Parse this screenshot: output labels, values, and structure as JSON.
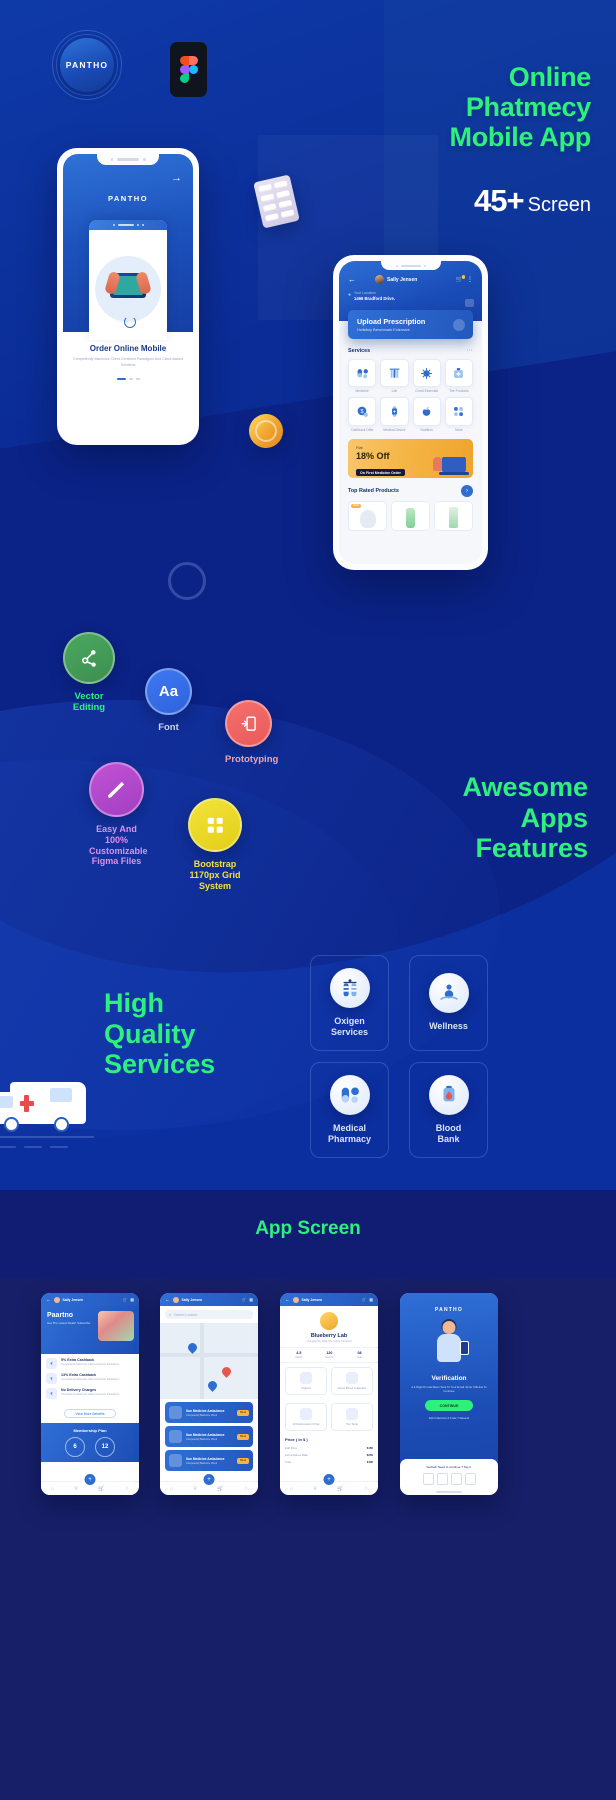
{
  "brand": {
    "name": "PANTHO",
    "figma_icon": "figma-icon"
  },
  "hero": {
    "title_line1": "Online",
    "title_line2": "Phatmecy",
    "title_line3": "Mobile App",
    "screens_count": "45+",
    "screens_label": "Screen",
    "accent_green": "#2ef07d",
    "background_blue": "#0c2f9f"
  },
  "phone_onboarding": {
    "brand": "PANTHO",
    "next_icon": "arrow-right-icon",
    "heading": "Order Online Mobile",
    "paragraph": "Competently Maximize Client-Centered Paradigms And Client-Based Solutions",
    "illustration": "tablet-in-hands-illustration"
  },
  "phone_home": {
    "back_icon": "arrow-left-icon",
    "user_name": "Sally Jensen",
    "avatar": "user-avatar",
    "cart_icon": "cart-icon",
    "menu_icon": "more-vertical-icon",
    "grid_icon": "grid-icon",
    "location_label": "Your Location",
    "location_value": "1466  Bradford Drive.",
    "upload_title": "Upload Prescription",
    "upload_subtitle": "Holisticly Benchmark Extensive",
    "upload_icon": "upload-icon",
    "services_title": "Services",
    "services_more_icon": "more-dots-icon",
    "services": [
      {
        "label": "Medicine",
        "icon": "capsule-icon"
      },
      {
        "label": "Lab",
        "icon": "test-tubes-icon"
      },
      {
        "label": "Covid Essential",
        "icon": "virus-icon"
      },
      {
        "label": "The Products",
        "icon": "hospital-icon"
      },
      {
        "label": "Cashback Offer",
        "icon": "cashback-icon"
      },
      {
        "label": "Medical Device",
        "icon": "smartwatch-icon"
      },
      {
        "label": "Nutrition",
        "icon": "nutrition-icon"
      },
      {
        "label": "More",
        "icon": "grid-more-icon"
      }
    ],
    "offer": {
      "flat_label": "Flat",
      "percent": "18% Off",
      "condition": "On First Medicine Order"
    },
    "top_rated_title": "Top Rated Products",
    "top_rated_more_icon": "chevron-right-icon",
    "top_products": [
      {
        "tag": "NEW",
        "art": "device-product"
      },
      {
        "tag": "",
        "art": "bottle-product"
      },
      {
        "tag": "",
        "art": "tube-product"
      }
    ]
  },
  "features": {
    "items": [
      {
        "label_line1": "Vector",
        "label_line2": "Editing",
        "icon": "pen-tool-icon",
        "color": "#4aa85f",
        "text_color": "#2ef07d"
      },
      {
        "label_line1": "Font",
        "label_line2": "",
        "icon": "Aa",
        "color": "#3e79f0",
        "text_color": "#c9d4ea"
      },
      {
        "label_line1": "Prototyping",
        "label_line2": "",
        "icon": "prototype-icon",
        "color": "#f4706e",
        "text_color": "#f6a3a0"
      },
      {
        "label_line1": "Easy And",
        "label_line2": "100%",
        "label_line3": "Customizable",
        "label_line4": "Figma Files",
        "icon": "pencil-icon",
        "color": "#c252d6",
        "text_color": "#e08fe8"
      },
      {
        "label_line1": "Bootstrap",
        "label_line2": "1170px Grid",
        "label_line3": "System",
        "icon": "grid-icon",
        "color": "#f2e23a",
        "text_color": "#f2e23a"
      }
    ],
    "heading_line1": "Awesome",
    "heading_line2": "Apps",
    "heading_line3": "Features"
  },
  "services_section": {
    "heading_line1": "High",
    "heading_line2": "Quality",
    "heading_line3": "Services",
    "cards": [
      {
        "label_line1": "Oxigen",
        "label_line2": "Services",
        "icon": "oxygen-cylinder-icon"
      },
      {
        "label_line1": "Wellness",
        "label_line2": "",
        "icon": "meditation-icon"
      },
      {
        "label_line1": "Medical",
        "label_line2": "Pharmacy",
        "icon": "pills-icon"
      },
      {
        "label_line1": "Blood",
        "label_line2": "Bank",
        "icon": "blood-bag-icon"
      }
    ],
    "ambulance_icon": "ambulance-illustration"
  },
  "app_screens": {
    "heading": "App Screen",
    "screens": [
      {
        "name": "offers-screen",
        "user": "Sally Jensen",
        "hero_title": "Paartno",
        "hero_sub": "Get The Latest Deals! Subscribe",
        "rows": [
          {
            "badge": "₹",
            "title": "5% Extra Cashback",
            "sub": "Competently Maximize Client-Centered Paradigms"
          },
          {
            "badge": "₹",
            "title": "13% Extra Cashback",
            "sub": "Competently Maximize Client-Centered Paradigms"
          },
          {
            "badge": "₹",
            "title": "No Delivery Charges",
            "sub": "Competently Maximize Client-Centered Paradigms"
          }
        ],
        "more_button": "View More Benefits",
        "plan_title": "Membership Plan",
        "plan_options": [
          "6",
          "12"
        ],
        "fab_icon": "plus-icon",
        "nav": [
          "home-icon",
          "search-icon",
          "cart-icon",
          "profile-icon"
        ]
      },
      {
        "name": "map-screen",
        "user": "Sally Jensen",
        "search_placeholder": "Search Location",
        "map_icon": "map-pin-icon",
        "cards": [
          {
            "title": "Sun Medicine Ambulance",
            "sub": "Competently Maximize Client",
            "badge": "Book"
          },
          {
            "title": "Sun Medicine Ambulance",
            "sub": "Competently Maximize Client",
            "badge": "Book"
          },
          {
            "title": "Sun Medicine Ambulance",
            "sub": "Competently Maximize Client",
            "badge": "Book"
          }
        ],
        "fab_icon": "plus-icon"
      },
      {
        "name": "lab-detail-screen",
        "user": "Sally Jensen",
        "title": "Blueberry Lab",
        "subtitle": "Competently Maximize Client-Centered",
        "stats": [
          {
            "value": "4.5",
            "label": "Rating"
          },
          {
            "value": "120",
            "label": "Reports"
          },
          {
            "value": "08",
            "label": "Years"
          }
        ],
        "cards": [
          {
            "label": "Highest",
            "icon": "lab-icon"
          },
          {
            "label": "Home Blood Collection",
            "icon": "home-icon"
          },
          {
            "label": "Fast Tests",
            "icon": "speed-icon"
          }
        ],
        "sub_cards": [
          {
            "label": "100 Estimated of Pak",
            "icon": "chart-icon"
          },
          {
            "label": "Top Tests",
            "icon": "star-icon"
          }
        ],
        "price_title": "Price ( In $ )",
        "price_rows": [
          {
            "key": "Half Price",
            "value": "$156"
          },
          {
            "key": "Lab Advance Rate",
            "value": "$250"
          },
          {
            "key": "Total",
            "value": "$406"
          }
        ]
      },
      {
        "name": "verification-screen",
        "brand": "PANTHO",
        "title": "Verification",
        "subtitle": "A 4-Digit Pin Has Been Sent To Your Email. Enter It Below To Continue",
        "button": "CONTINUE",
        "link": "Didn't Receive A Code ? Resend",
        "sheet_hint": "Verified! Need to continue ? Tap it."
      }
    ]
  }
}
